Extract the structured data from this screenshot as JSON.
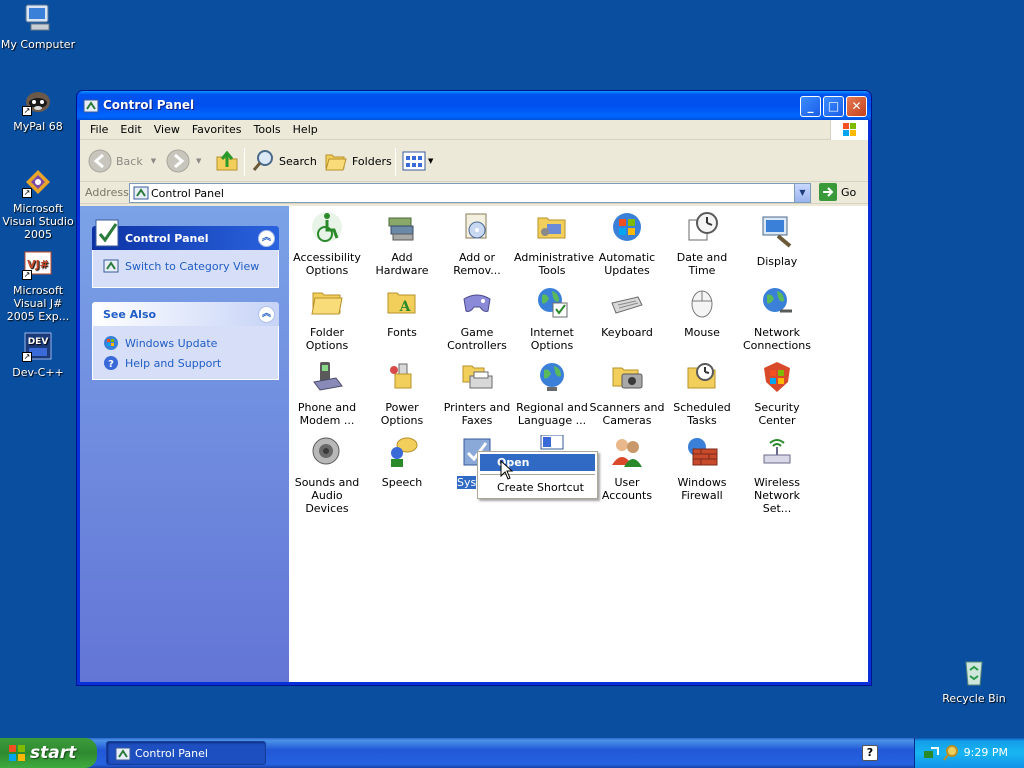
{
  "desktop": {
    "icons": [
      {
        "label": "My Computer",
        "icon": "my-computer-icon"
      },
      {
        "label": "MyPal 68",
        "icon": "mypal-icon"
      },
      {
        "label": "Microsoft Visual Studio 2005",
        "icon": "visual-studio-icon"
      },
      {
        "label": "Microsoft Visual J# 2005 Exp...",
        "icon": "visual-jsharp-icon"
      },
      {
        "label": "Dev-C++",
        "icon": "devcpp-icon"
      },
      {
        "label": "Recycle Bin",
        "icon": "recycle-bin-icon"
      }
    ]
  },
  "window": {
    "title": "Control Panel",
    "menu": [
      "File",
      "Edit",
      "View",
      "Favorites",
      "Tools",
      "Help"
    ],
    "toolbar": {
      "back": "Back",
      "search": "Search",
      "folders": "Folders"
    },
    "address": {
      "label": "Address",
      "value": "Control Panel",
      "go": "Go"
    }
  },
  "taskpane": {
    "main": {
      "title": "Control Panel",
      "link": "Switch to Category View"
    },
    "see_also": {
      "title": "See Also",
      "links": [
        "Windows Update",
        "Help and Support"
      ]
    }
  },
  "items": [
    {
      "label": "Accessibility Options",
      "icon": "accessibility-icon"
    },
    {
      "label": "Add Hardware",
      "icon": "add-hardware-icon"
    },
    {
      "label": "Add or Remov...",
      "icon": "add-remove-programs-icon"
    },
    {
      "label": "Administrative Tools",
      "icon": "administrative-tools-icon"
    },
    {
      "label": "Automatic Updates",
      "icon": "automatic-updates-icon"
    },
    {
      "label": "Date and Time",
      "icon": "date-time-icon"
    },
    {
      "label": "Display",
      "icon": "display-icon"
    },
    {
      "label": "Folder Options",
      "icon": "folder-options-icon"
    },
    {
      "label": "Fonts",
      "icon": "fonts-icon"
    },
    {
      "label": "Game Controllers",
      "icon": "game-controllers-icon"
    },
    {
      "label": "Internet Options",
      "icon": "internet-options-icon"
    },
    {
      "label": "Keyboard",
      "icon": "keyboard-icon"
    },
    {
      "label": "Mouse",
      "icon": "mouse-icon"
    },
    {
      "label": "Network Connections",
      "icon": "network-connections-icon"
    },
    {
      "label": "Phone and Modem ...",
      "icon": "phone-modem-icon"
    },
    {
      "label": "Power Options",
      "icon": "power-options-icon"
    },
    {
      "label": "Printers and Faxes",
      "icon": "printers-faxes-icon"
    },
    {
      "label": "Regional and Language ...",
      "icon": "regional-language-icon"
    },
    {
      "label": "Scanners and Cameras",
      "icon": "scanners-cameras-icon"
    },
    {
      "label": "Scheduled Tasks",
      "icon": "scheduled-tasks-icon"
    },
    {
      "label": "Security Center",
      "icon": "security-center-icon"
    },
    {
      "label": "Sounds and Audio Devices",
      "icon": "sounds-audio-icon"
    },
    {
      "label": "Speech",
      "icon": "speech-icon"
    },
    {
      "label": "Sys",
      "icon": "system-icon",
      "selected": true
    },
    {
      "label": "",
      "icon": "taskbar-start-menu-icon"
    },
    {
      "label": "User Accounts",
      "icon": "user-accounts-icon"
    },
    {
      "label": "Windows Firewall",
      "icon": "windows-firewall-icon"
    },
    {
      "label": "Wireless Network Set...",
      "icon": "wireless-network-icon"
    }
  ],
  "context_menu": {
    "items": [
      "Open",
      "Create Shortcut"
    ]
  },
  "taskbar": {
    "start": "start",
    "task": "Control Panel",
    "clock": "9:29 PM"
  },
  "colors": {
    "desktop": "#0a4f9f",
    "titlebar": "#0053ee",
    "selection": "#316ac5",
    "link": "#215dc6"
  }
}
